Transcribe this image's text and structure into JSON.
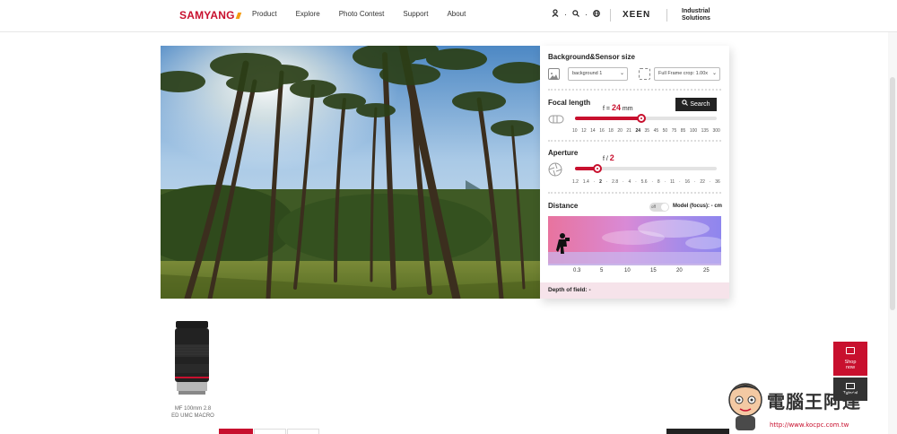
{
  "header": {
    "logo": "SAMYANG",
    "nav": [
      "Product",
      "Explore",
      "Photo Contest",
      "Support",
      "About"
    ],
    "icons": [
      "user-icon",
      "search-icon",
      "globe-icon"
    ],
    "brand2": "XEEN",
    "industrial_line1": "Industrial",
    "industrial_line2": "Solutions"
  },
  "simulator": {
    "bg_title": "Background&Sensor size",
    "background_select": "background 1",
    "sensor_select": "Full Frame crop: 1.00x",
    "focal_title": "Focal length",
    "focal_prefix": "f =",
    "focal_value": "24",
    "focal_unit": "mm",
    "search_label": "Search",
    "focal_scale": [
      "10",
      "12",
      "14",
      "16",
      "18",
      "20",
      "21",
      "24",
      "35",
      "45",
      "50",
      "75",
      "85",
      "100",
      "135",
      "300"
    ],
    "focal_selected": "24",
    "focal_progress": 0.47,
    "aperture_title": "Aperture",
    "aperture_prefix": "f /",
    "aperture_value": "2",
    "aperture_scale": [
      "1.2",
      "1.4",
      "·",
      "2",
      "·",
      "2.8",
      "·",
      "4",
      "·",
      "5.6",
      "·",
      "8",
      "·",
      "11",
      "·",
      "16",
      "·",
      "22",
      "·",
      "36"
    ],
    "aperture_selected": "2",
    "aperture_progress": 0.16,
    "distance_title": "Distance",
    "toggle_label": "off",
    "model_focus": "Model (focus): - cm",
    "distance_scale": [
      "0.3",
      "5",
      "10",
      "15",
      "20",
      "25"
    ],
    "dof_label": "Depth of field: -"
  },
  "lens": {
    "caption1": "MF 100mm 2.8",
    "caption2": "ED UMC MACRO"
  },
  "side": {
    "shop_label1": "Shop",
    "shop_label2": "now",
    "yt_label": "Tutorial"
  },
  "watermark": {
    "text": "電腦王阿達",
    "url": "http://www.kocpc.com.tw"
  },
  "colors": {
    "accent": "#c8102e",
    "dark": "#222222"
  }
}
